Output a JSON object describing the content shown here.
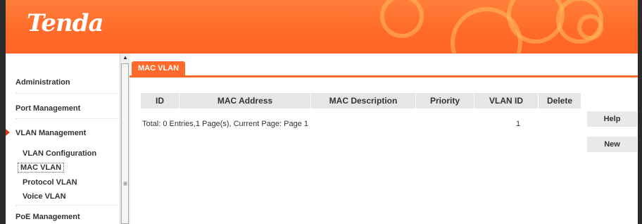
{
  "brand": {
    "logo_text": "Tenda"
  },
  "sidebar": {
    "sections": [
      {
        "label": "Administration"
      },
      {
        "label": "Port Management"
      },
      {
        "label": "VLAN Management",
        "expanded": true
      },
      {
        "label": "PoE Management"
      }
    ],
    "vlan_items": [
      {
        "label": "VLAN Configuration"
      },
      {
        "label": "MAC VLAN",
        "active": true
      },
      {
        "label": "Protocol VLAN"
      },
      {
        "label": "Voice VLAN"
      }
    ]
  },
  "main": {
    "tab_label": "MAC VLAN",
    "table": {
      "columns": [
        "ID",
        "MAC Address",
        "MAC Description",
        "Priority",
        "VLAN ID",
        "Delete"
      ],
      "rows": []
    },
    "total_text": "Total: 0 Entries,1 Page(s), Current Page: Page 1",
    "page_value": "1"
  },
  "buttons": {
    "help_label": "Help",
    "new_label": "New"
  },
  "colors": {
    "accent": "#ff6a2a",
    "header_bg": "#ff7f3a",
    "table_header_bg": "#e6e6e6",
    "text": "#333333",
    "button_bg": "#e9e9e9"
  }
}
